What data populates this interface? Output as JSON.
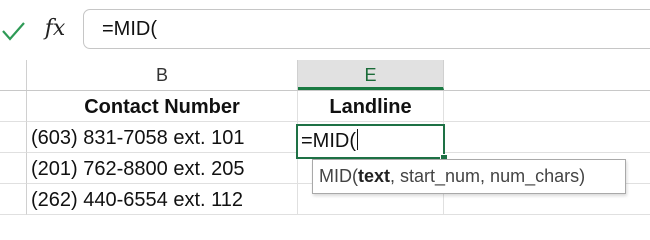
{
  "formula_bar": {
    "enter_icon": "checkmark-icon",
    "function_icon": "fx-icon",
    "function_label": "fx",
    "content": "=MID("
  },
  "columns": [
    {
      "letter": "B",
      "active": false
    },
    {
      "letter": "E",
      "active": true
    }
  ],
  "table": {
    "headers": [
      "Contact Number",
      "Landline"
    ],
    "rows": [
      [
        "(603) 831-7058 ext. 101",
        "=MID("
      ],
      [
        "(201) 762-8800 ext. 205",
        ""
      ],
      [
        "(262) 440-6554 ext. 112",
        ""
      ]
    ]
  },
  "tooltip": {
    "function_name": "MID(",
    "current_arg": "text",
    "rest": ", start_num, num_chars)"
  },
  "colors": {
    "accent": "#1e7145",
    "check_green": "#2e9a56"
  }
}
